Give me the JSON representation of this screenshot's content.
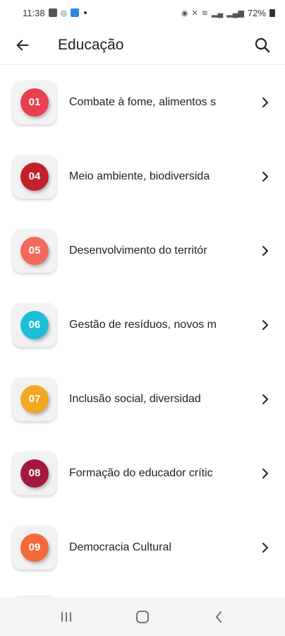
{
  "status_bar": {
    "time": "11:38",
    "battery": "72%"
  },
  "header": {
    "title": "Educação",
    "back_icon": "arrow-left-icon",
    "search_icon": "search-icon"
  },
  "items": [
    {
      "number": "01",
      "label": "Combate à fome, alimentos s",
      "color": "#e8404f"
    },
    {
      "number": "04",
      "label": "Meio ambiente, biodiversida",
      "color": "#c2212c"
    },
    {
      "number": "05",
      "label": "Desenvolvimento do territór",
      "color": "#f26a5b"
    },
    {
      "number": "06",
      "label": "Gestão de resíduos, novos m",
      "color": "#1bbfd8"
    },
    {
      "number": "07",
      "label": "Inclusão social, diversidad",
      "color": "#f5a623"
    },
    {
      "number": "08",
      "label": "Formação do educador crític",
      "color": "#a3193e"
    },
    {
      "number": "09",
      "label": "Democracia Cultural",
      "color": "#f26a3c"
    }
  ],
  "nav": {
    "recents_icon": "recents-icon",
    "home_icon": "home-icon",
    "back_icon": "back-icon"
  }
}
